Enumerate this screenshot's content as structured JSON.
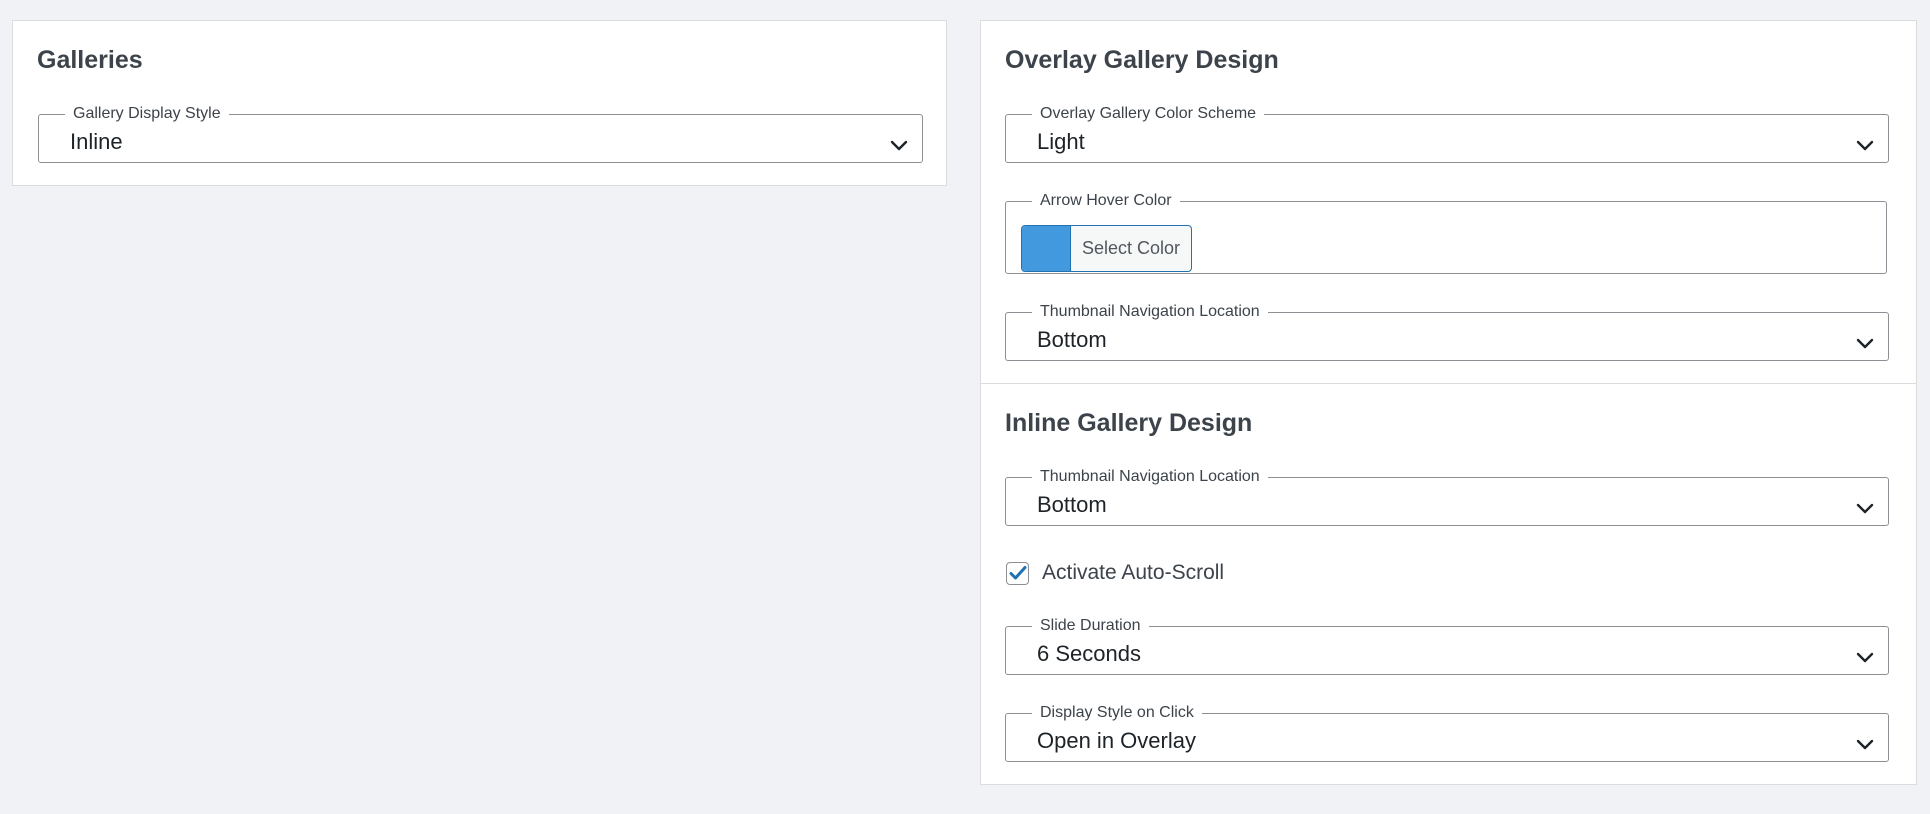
{
  "galleries": {
    "title": "Galleries",
    "display_style": {
      "label": "Gallery Display Style",
      "value": "Inline"
    }
  },
  "overlay_design": {
    "title": "Overlay Gallery Design",
    "color_scheme": {
      "label": "Overlay Gallery Color Scheme",
      "value": "Light"
    },
    "arrow_hover_color": {
      "label": "Arrow Hover Color",
      "button_label": "Select Color",
      "color": "#4299dd"
    },
    "thumbnail_nav": {
      "label": "Thumbnail Navigation Location",
      "value": "Bottom"
    }
  },
  "inline_design": {
    "title": "Inline Gallery Design",
    "thumbnail_nav": {
      "label": "Thumbnail Navigation Location",
      "value": "Bottom"
    },
    "auto_scroll": {
      "label": "Activate Auto-Scroll",
      "checked": true
    },
    "slide_duration": {
      "label": "Slide Duration",
      "value": "6 Seconds"
    },
    "display_on_click": {
      "label": "Display Style on Click",
      "value": "Open in Overlay"
    }
  },
  "colors": {
    "accent": "#2271b1",
    "checkmark": "#2271b1",
    "page_background": "#f0f2f5"
  },
  "icons": {
    "select_chevron": "chevron-down-icon",
    "checkbox_check": "checkmark-icon"
  }
}
